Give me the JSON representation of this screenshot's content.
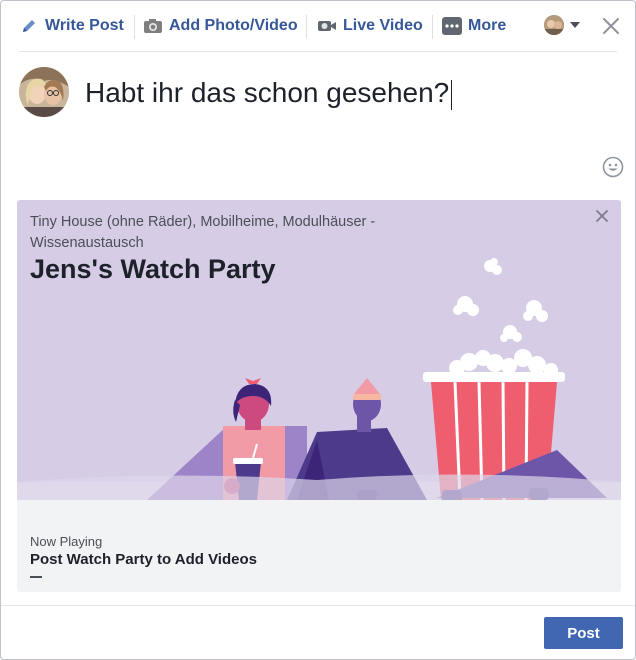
{
  "toolbar": {
    "write_post": "Write Post",
    "add_photo_video": "Add Photo/Video",
    "live_video": "Live Video",
    "more": "More"
  },
  "composer": {
    "text": "Habt ihr das schon gesehen?"
  },
  "card": {
    "group_name": "Tiny House (ohne Räder), Mobilheime, Modulhäuser - Wissenaustausch",
    "title": "Jens's Watch Party",
    "now_playing_label": "Now Playing",
    "now_playing_title": "Post Watch Party to Add Videos"
  },
  "actions": {
    "post_label": "Post"
  },
  "colors": {
    "brand_blue": "#4267b2",
    "link_blue": "#365899",
    "hero_bg": "#d7cce6",
    "popcorn_red": "#ef5e6f"
  }
}
